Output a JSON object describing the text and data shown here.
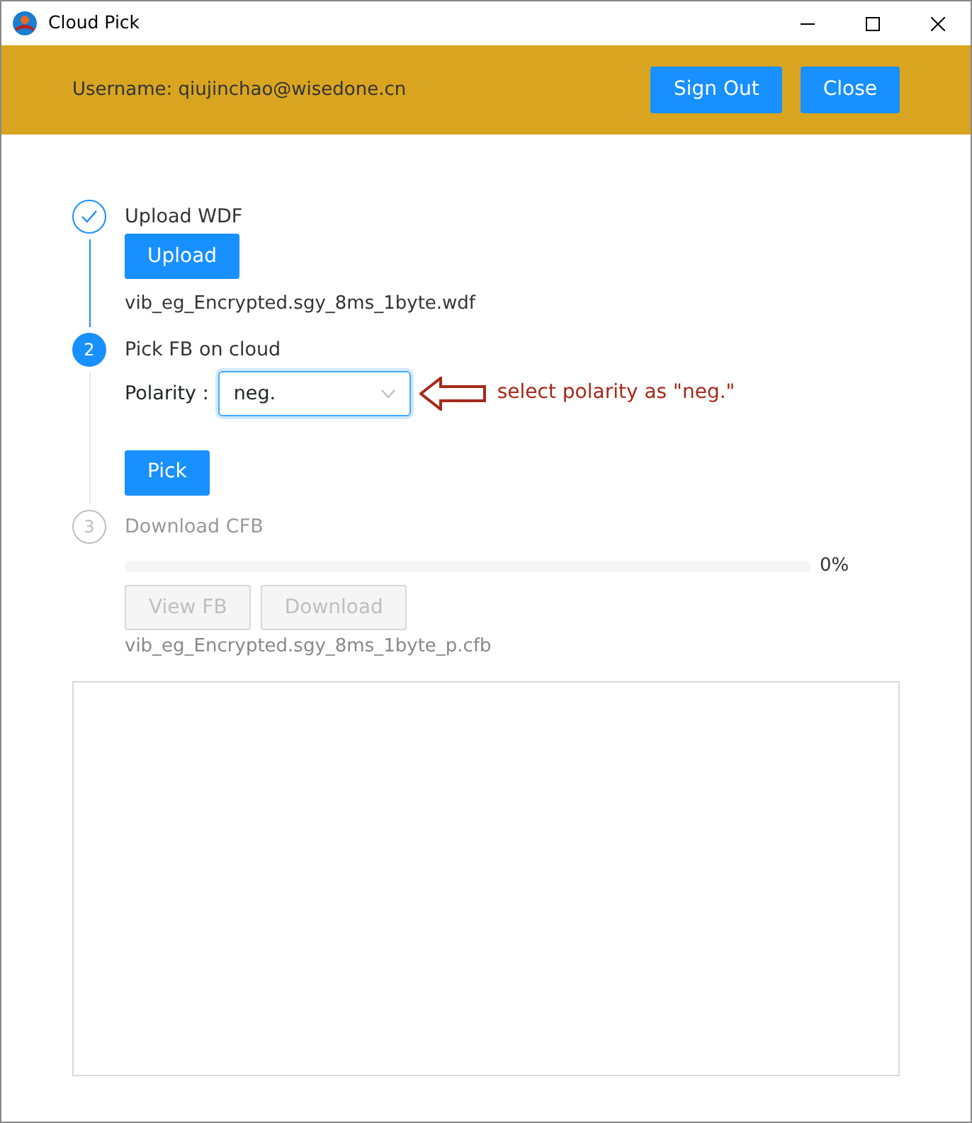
{
  "window": {
    "title": "Cloud Pick"
  },
  "header": {
    "username": "Username: qiujinchao@wisedone.cn",
    "buttons": [
      "Sign Out",
      "Close"
    ]
  },
  "steps": [
    {
      "completed": true,
      "title": "Upload WDF",
      "items": [
        {
          "kind": "button",
          "label": "Upload",
          "disabled": false
        },
        {
          "kind": "file",
          "text": "vib_eg_Encrypted.sgy_8ms_1byte.wdf"
        }
      ]
    },
    {
      "completed": false,
      "number": "2",
      "title": "Pick FB on cloud",
      "items": [
        {
          "kind": "select",
          "label": "Polarity :",
          "value": "neg.",
          "annotation": "select polarity as \"neg.\""
        },
        {
          "kind": "button",
          "label": "Pick",
          "disabled": false
        }
      ]
    },
    {
      "completed": false,
      "number": "3",
      "title": "Download CFB",
      "items": [
        {
          "kind": "progress",
          "level": 0,
          "reading": "0%"
        },
        {
          "kind": "buttons",
          "buttons": [
            {
              "label": "View FB",
              "disabled": true
            },
            {
              "label": "Download",
              "disabled": true
            }
          ]
        },
        {
          "kind": "file",
          "text": "vib_eg_Encrypted.sgy_8ms_1byte_p.cfb"
        }
      ]
    }
  ],
  "log": {
    "kind": "textarea"
  }
}
